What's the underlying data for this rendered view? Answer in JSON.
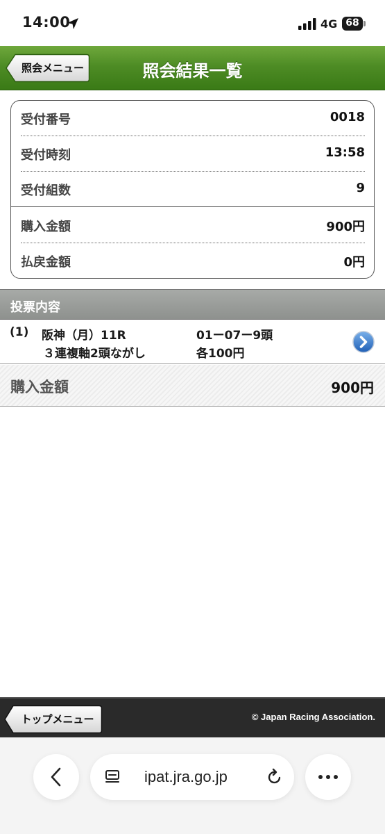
{
  "status_bar": {
    "time": "14:00",
    "network": "4G",
    "battery": "68"
  },
  "header": {
    "back_label": "照会メニュー",
    "title": "照会結果一覧"
  },
  "summary": {
    "rows": [
      {
        "label": "受付番号",
        "value": "0018"
      },
      {
        "label": "受付時刻",
        "value": "13:58"
      },
      {
        "label": "受付組数",
        "value": "9"
      },
      {
        "label": "購入金額",
        "value": "900円"
      },
      {
        "label": "払戻金額",
        "value": "0円"
      }
    ]
  },
  "bets": {
    "section_title": "投票内容",
    "items": [
      {
        "number": "(1)",
        "race": "阪神（月）11R",
        "horses": "01ー07ー9頭",
        "type": "３連複軸2頭ながし",
        "amount": "各100円"
      }
    ]
  },
  "total": {
    "label": "購入金額",
    "value": "900円"
  },
  "footer": {
    "top_menu_label": "トップメニュー",
    "copyright": "© Japan Racing Association."
  },
  "browser": {
    "url": "ipat.jra.go.jp"
  },
  "colors": {
    "header_green": "#4e8c25",
    "section_gray": "#9a9d9a",
    "footer_dark": "#2a2a2a"
  }
}
